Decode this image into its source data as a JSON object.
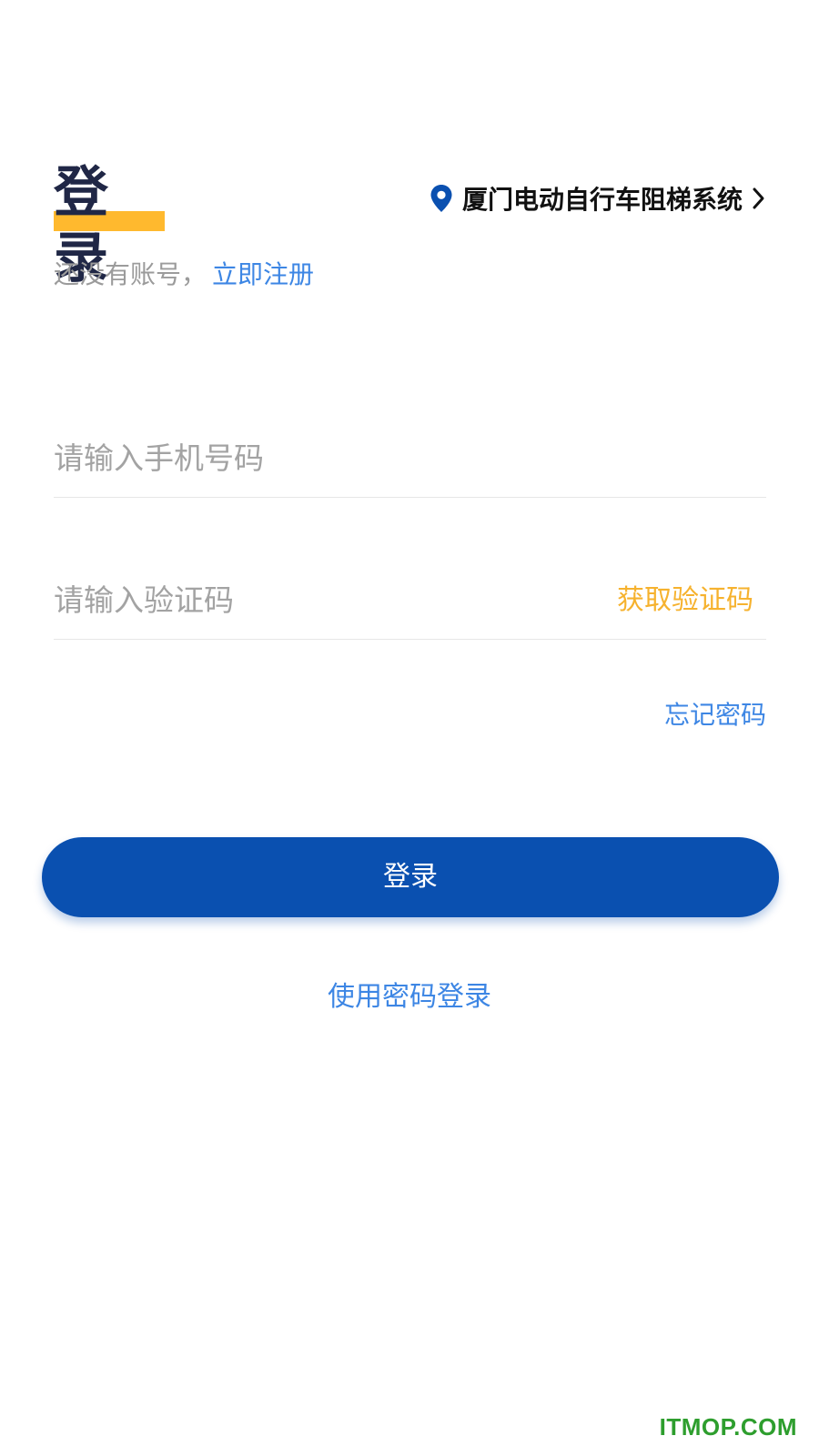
{
  "header": {
    "title": "登录",
    "system_name": "厦门电动自行车阻梯系统",
    "location_icon": "map-pin-icon",
    "chevron_icon": "chevron-right-icon"
  },
  "register": {
    "prompt": "还没有账号，",
    "link": "立即注册"
  },
  "form": {
    "phone_placeholder": "请输入手机号码",
    "code_placeholder": "请输入验证码",
    "get_code_label": "获取验证码",
    "forgot_label": "忘记密码"
  },
  "actions": {
    "login_label": "登录",
    "password_login_label": "使用密码登录"
  },
  "watermark": "ITMOP.COM",
  "colors": {
    "brand_blue": "#0A50B0",
    "link_blue": "#3D86E4",
    "accent_yellow": "#FFB92E",
    "code_orange": "#F6B22E",
    "title_navy": "#202746",
    "watermark_green": "#2E9E2E"
  }
}
